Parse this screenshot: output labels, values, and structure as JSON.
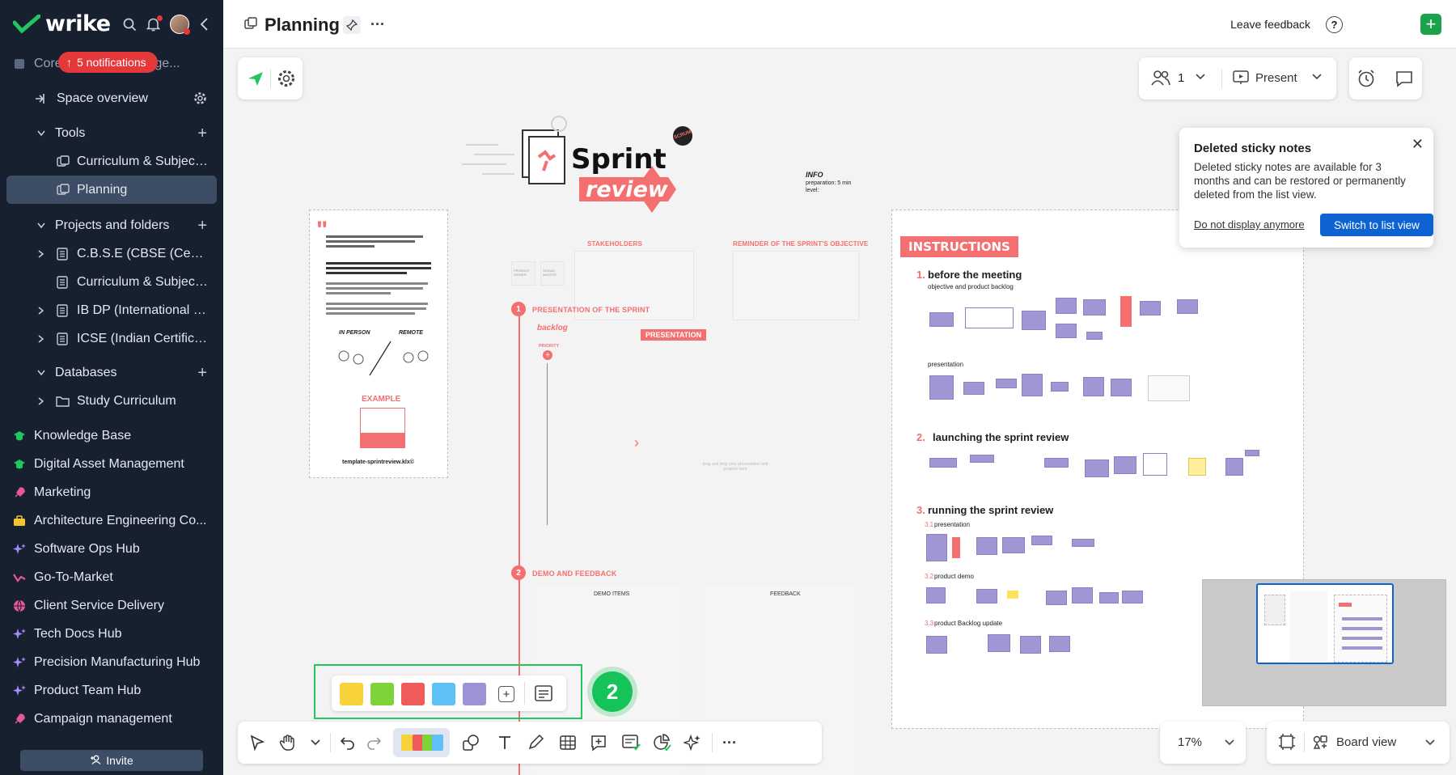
{
  "app": {
    "logo_text": "wrike",
    "accent": "#1aa34a",
    "sidebar_bg": "#16202f"
  },
  "header": {
    "notifications_label": "5 notifications",
    "space_name": "Core Curriculum Sugge..."
  },
  "sidebar": {
    "space_overview": "Space overview",
    "tools_label": "Tools",
    "tools": [
      "Curriculum & Subject ...",
      "Planning"
    ],
    "projects_label": "Projects and folders",
    "projects": [
      "C.B.S.E (CBSE (Centr...",
      "Curriculum & Subject ...",
      "IB DP (International B...",
      "ICSE (Indian Certificat..."
    ],
    "databases_label": "Databases",
    "databases": [
      "Study Curriculum"
    ],
    "spaces": [
      "Knowledge Base",
      "Digital Asset Management",
      "Marketing",
      "Architecture Engineering Co...",
      "Software Ops Hub",
      "Go-To-Market",
      "Client Service Delivery",
      "Tech Docs Hub",
      "Precision Manufacturing Hub",
      "Product Team Hub",
      "Campaign management"
    ],
    "invite_label": "Invite"
  },
  "topbar": {
    "title": "Planning",
    "leave_feedback": "Leave feedback",
    "help": "?"
  },
  "board_controls": {
    "participants": "1",
    "present": "Present"
  },
  "toast": {
    "title": "Deleted sticky notes",
    "body": "Deleted sticky notes are available for 3 months and can be restored or permanently deleted from the list view.",
    "dismiss": "Do not display anymore",
    "action": "Switch to list view"
  },
  "canvas": {
    "sprint": "Sprint",
    "review": "review",
    "scrum": "SCRUM",
    "info": "INFO",
    "preparation": "preparation: 5 min",
    "level": "level:",
    "stakeholders": "STAKEHOLDERS",
    "reminder": "REMINDER OF THE SPRINT'S OBJECTIVE",
    "product_owner": "PRODUCT OWNER",
    "scrum_master": "SCRUM MASTER",
    "presentation_sprint": "PRESENTATION OF THE SPRINT",
    "backlog": "backlog",
    "priority": "PRIORITY",
    "presentation": "PRESENTATION",
    "drop_hint": "drag and drop your presentation and projects here",
    "demo_feedback": "DEMO AND FEEDBACK",
    "demo_items": "DEMO ITEMS",
    "feedback": "FEEDBACK",
    "in_person": "IN PERSON",
    "remote": "REMOTE",
    "example": "EXAMPLE",
    "template_credit": "template-sprintreview.klx©",
    "instructions": "INSTRUCTIONS",
    "step1": "before the meeting",
    "step1_sub1": "objective and product backlog",
    "step1_sub2": "presentation",
    "step2": "launching the sprint review",
    "step3": "running the sprint review",
    "step3_1": "presentation",
    "step3_2": "product demo",
    "step3_3": "product Backlog update",
    "n1": "1.",
    "n2": "2.",
    "n3": "3.",
    "n31": "3.1",
    "n32": "3.2",
    "n33": "3.3",
    "s1": "1",
    "s2": "2"
  },
  "sticky_colors": [
    "#f7d23a",
    "#7ed23a",
    "#f05a5a",
    "#5fc0f5",
    "#9b93d6"
  ],
  "step_badge": "2",
  "zoom": "17%",
  "view": "Board view"
}
